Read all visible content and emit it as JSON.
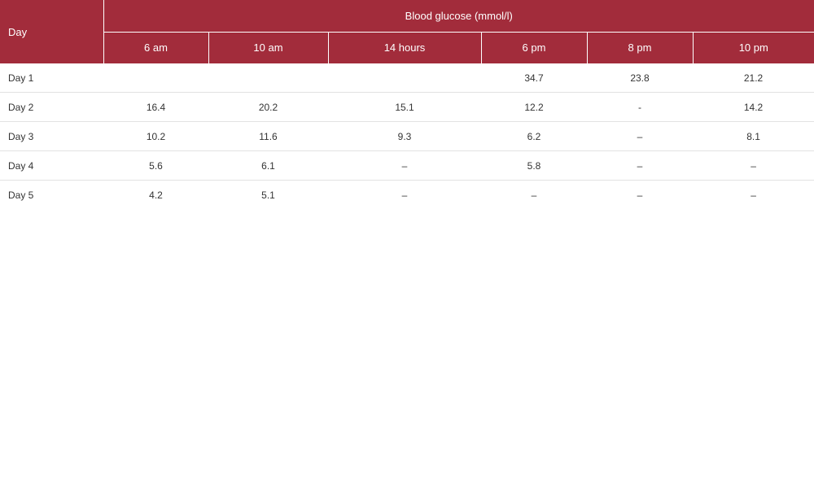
{
  "table": {
    "day_header": "Day",
    "group_header": "Blood glucose (mmol/l)",
    "time_headers": [
      "6 am",
      "10 am",
      "14 hours",
      "6 pm",
      "8 pm",
      "10 pm"
    ],
    "rows": [
      {
        "day": "Day 1",
        "values": [
          "",
          "",
          "",
          "34.7",
          "23.8",
          "21.2"
        ]
      },
      {
        "day": "Day 2",
        "values": [
          "16.4",
          "20.2",
          "15.1",
          "12.2",
          "-",
          "14.2"
        ]
      },
      {
        "day": "Day 3",
        "values": [
          "10.2",
          "11.6",
          "9.3",
          "6.2",
          "–",
          "8.1"
        ]
      },
      {
        "day": "Day 4",
        "values": [
          "5.6",
          "6.1",
          "–",
          "5.8",
          "–",
          "–"
        ]
      },
      {
        "day": "Day 5",
        "values": [
          "4.2",
          "5.1",
          "–",
          "–",
          "–",
          "–"
        ]
      }
    ]
  },
  "colors": {
    "header_background": "#a22c3b",
    "header_text": "#ffffff",
    "row_divider": "#e2e2e2",
    "body_text": "#333333"
  }
}
